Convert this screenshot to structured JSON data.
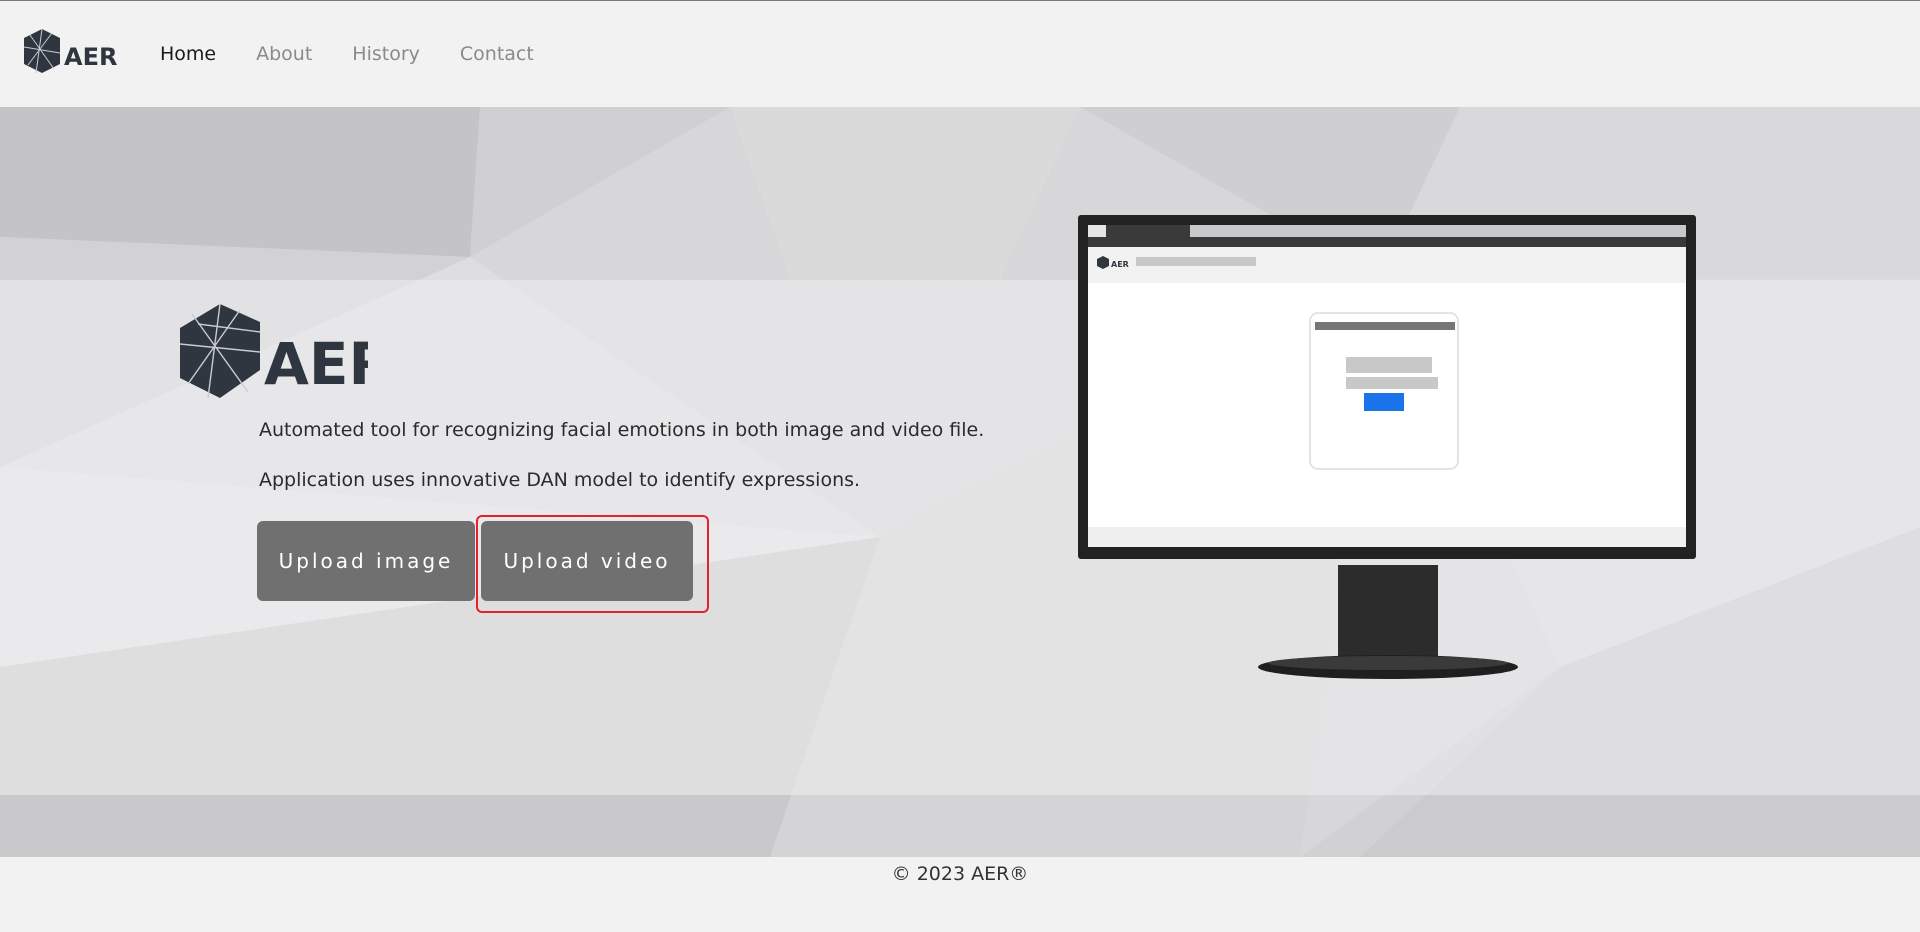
{
  "nav": {
    "logo_text": "AER",
    "links": [
      {
        "label": "Home",
        "active": true
      },
      {
        "label": "About",
        "active": false
      },
      {
        "label": "History",
        "active": false
      },
      {
        "label": "Contact",
        "active": false
      }
    ]
  },
  "hero": {
    "logo_text": "AER",
    "line1": "Automated tool for recognizing facial emotions in both image and video file.",
    "line2": "Application uses innovative DAN model to identify expressions.",
    "buttons": {
      "upload_image": "Upload image",
      "upload_video": "Upload video"
    },
    "monitor_mini_logo": "AER"
  },
  "footer": {
    "text": "© 2023 AER®"
  },
  "colors": {
    "page_bg": "#f2f2f2",
    "button_bg": "#707070",
    "highlight": "#e8202a",
    "logo_dark": "#2f3640",
    "monitor_button": "#1a73e8"
  }
}
